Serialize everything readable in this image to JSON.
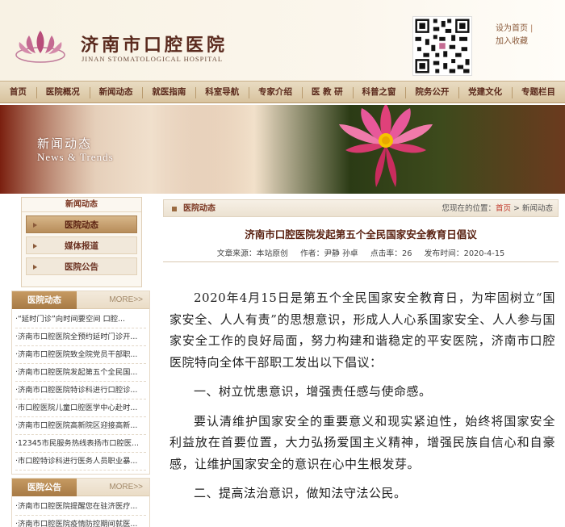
{
  "header": {
    "hospital_name": "济南市口腔医院",
    "hospital_name_en": "JINAN STOMATOLOGICAL HOSPITAL",
    "links": [
      "设为首页",
      "加入收藏"
    ]
  },
  "nav": {
    "items": [
      "首页",
      "医院概况",
      "新闻动态",
      "就医指南",
      "科室导航",
      "专家介绍",
      "医 教 研",
      "科普之窗",
      "院务公开",
      "党建文化",
      "专题栏目"
    ]
  },
  "banner": {
    "title": "新闻动态",
    "subtitle": "News & Trends"
  },
  "sidenav": {
    "title": "新闻动态",
    "items": [
      "医院动态",
      "媒体报道",
      "医院公告"
    ],
    "active_index": 0
  },
  "news_box": {
    "title": "医院动态",
    "more": "MORE>>",
    "items": [
      "·“延时门诊”向时间要空间 口腔...",
      "·济南市口腔医院全预约延时门诊开...",
      "·济南市口腔医院致全院党员干部职...",
      "·济南市口腔医院发起第五个全民国...",
      "·济南市口腔医院特诊科进行口腔诊...",
      "·市口腔医院儿童口腔医学中心赴时...",
      "·济南市口腔医院高新院区迎接高新...",
      "·12345市民服务热线表扬市口腔医...",
      "·市口腔特诊科进行医务人员职业暴..."
    ]
  },
  "notice_box": {
    "title": "医院公告",
    "more": "MORE>>",
    "items": [
      "·济南市口腔医院提醒您在驻济医疗...",
      "·济南市口腔医院疫情防控期间就医..."
    ]
  },
  "breadcrumb": {
    "section": "医院动态",
    "prefix": "您现在的位置：",
    "home": "首页",
    "sep": " > ",
    "current": "新闻动态"
  },
  "article": {
    "title": "济南市口腔医院发起第五个全民国家安全教育日倡议",
    "source": "文章来源：本站原创",
    "author": "作者：尹静 孙卓",
    "hits": "点击率：26",
    "date": "发布时间：2020-4-15",
    "paragraphs": [
      "2020年4月15日是第五个全民国家安全教育日，为牢固树立“国家安全、人人有责”的思想意识，形成人人心系国家安全、人人参与国家安全工作的良好局面，努力构建和谐稳定的平安医院，济南市口腔医院特向全体干部职工发出以下倡议：",
      "一、树立忧患意识，增强责任感与使命感。",
      "要认清维护国家安全的重要意义和现实紧迫性，始终将国家安全利益放在首要位置，大力弘扬爱国主义精神，增强民族自信心和自豪感，让维护国家安全的意识在心中生根发芽。",
      "二、提高法治意识，做知法守法公民。"
    ]
  },
  "colors": {
    "brand": "#5a2a1e",
    "accent": "#b78d5a",
    "link_red": "#c0392b"
  }
}
